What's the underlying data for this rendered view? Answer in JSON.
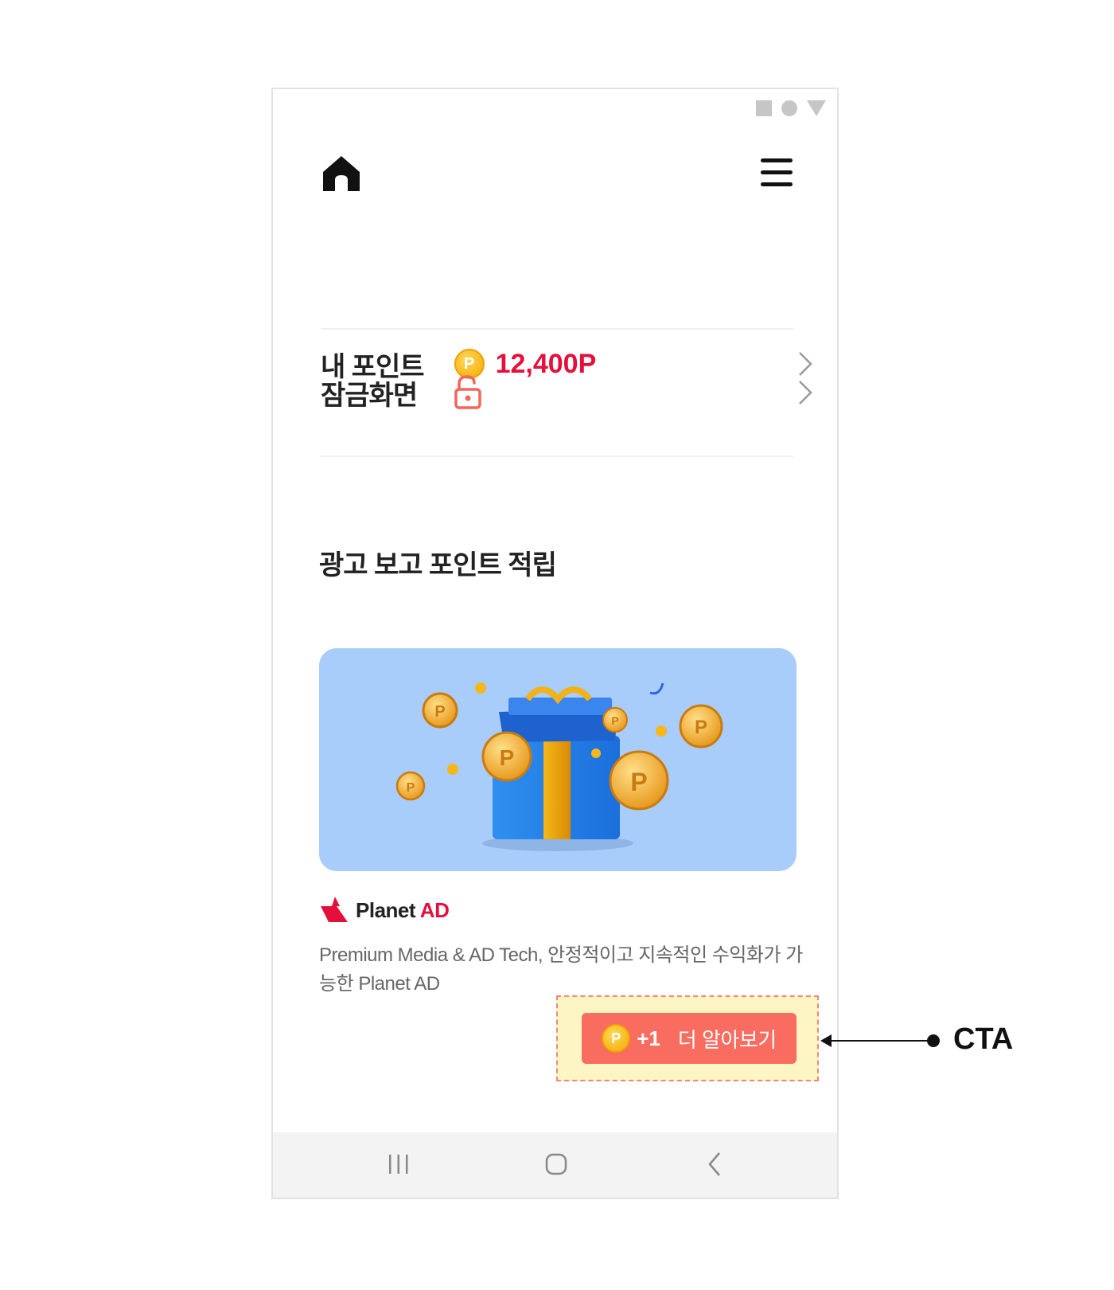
{
  "status_bar": {
    "icons": [
      "square-icon",
      "circle-icon",
      "triangle-icon"
    ]
  },
  "header": {
    "home_icon": "home-icon",
    "menu_icon": "hamburger-menu-icon"
  },
  "rows": {
    "points": {
      "label": "내 포인트",
      "coin_letter": "P",
      "value": "12,400P"
    },
    "lock": {
      "label": "잠금화면"
    }
  },
  "section": {
    "title": "광고 보고 포인트 적립"
  },
  "ad": {
    "brand_name": "Planet",
    "brand_accent": "AD",
    "description": "Premium Media & AD Tech, 안정적이고 지속적인 수익화가 가능한 Planet AD",
    "cta": {
      "coin_letter": "P",
      "bonus": "+1",
      "label": "더 알아보기"
    }
  },
  "annotation": {
    "label": "CTA"
  },
  "colors": {
    "accent_red": "#e3103c",
    "cta": "#f96c60",
    "highlight": "#fdf6c4",
    "banner": "#a9cdfb",
    "coin": "#f5a800"
  }
}
